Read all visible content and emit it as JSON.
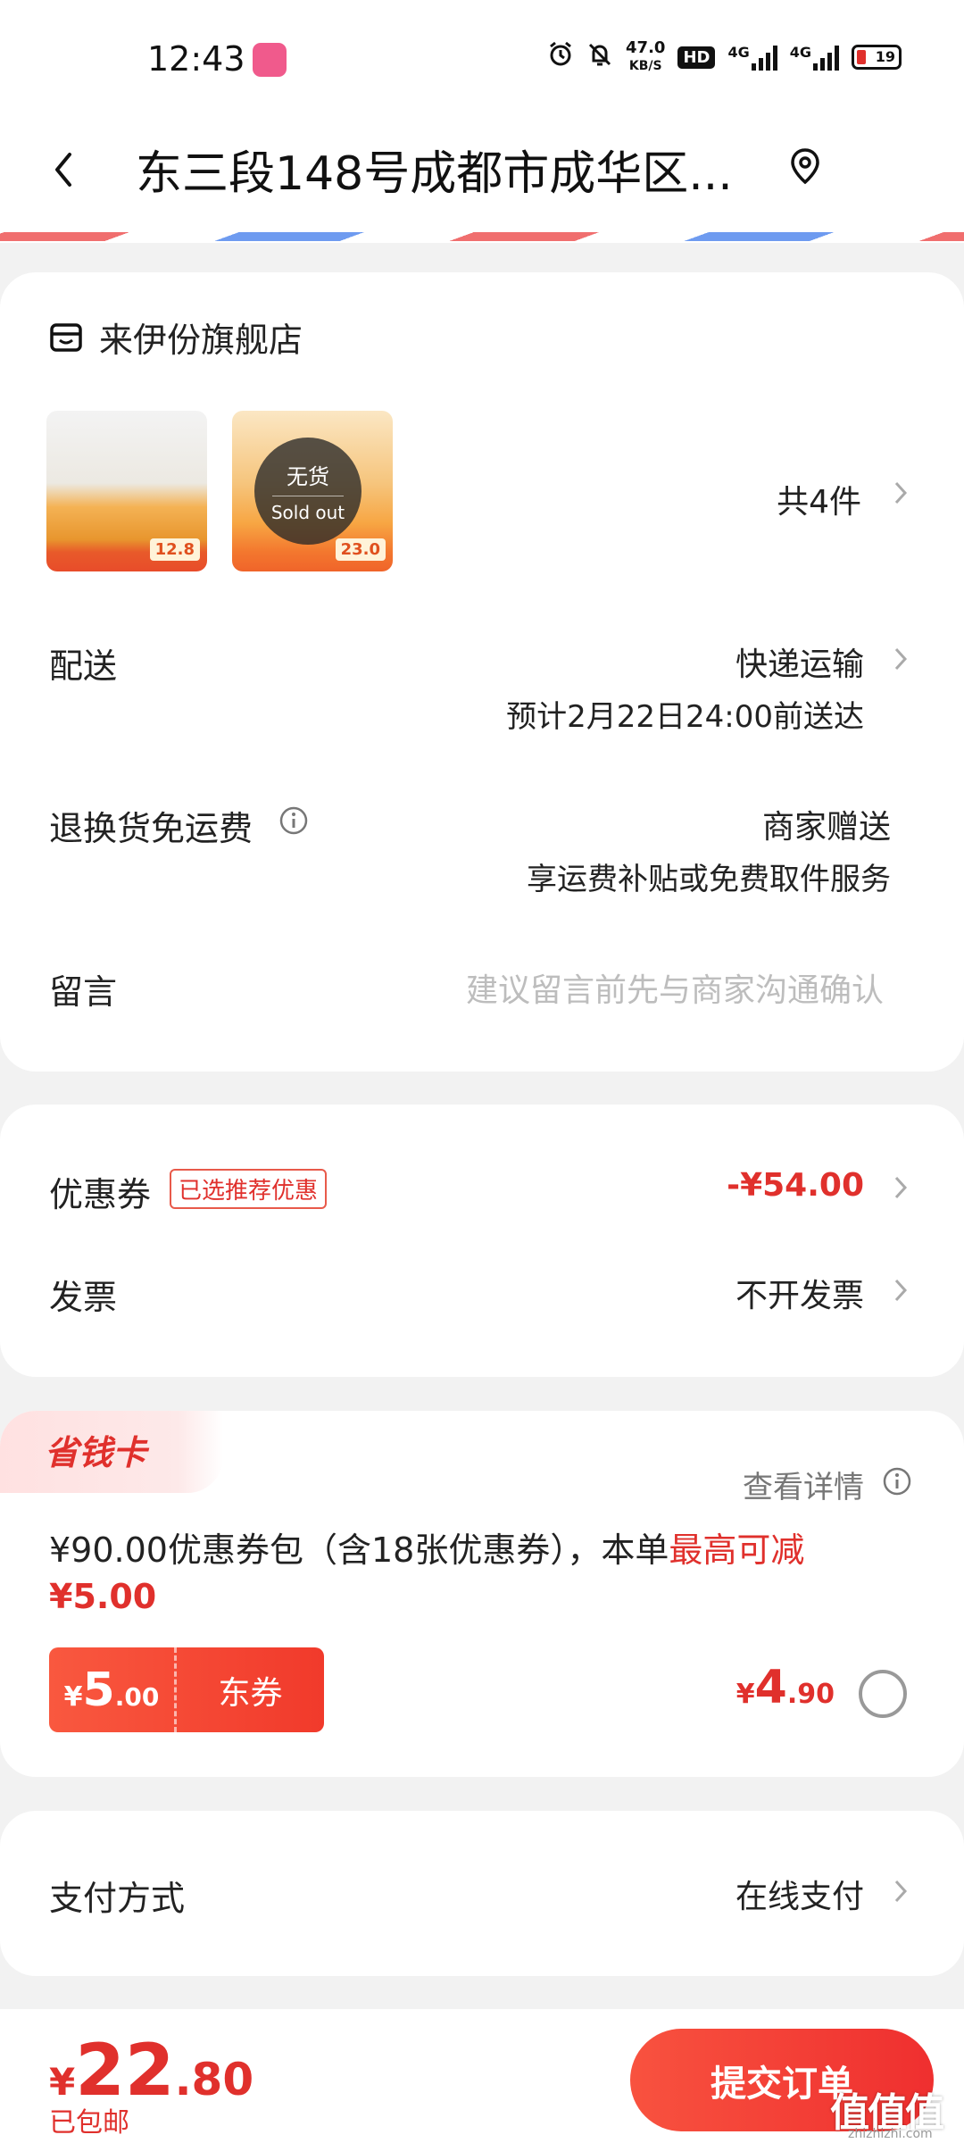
{
  "status_bar": {
    "time": "12:43",
    "net_speed_value": "47.0",
    "net_speed_unit": "KB/S",
    "hd_label": "HD",
    "signal1_label": "4G",
    "signal2_label": "4G",
    "battery": "19"
  },
  "header": {
    "title": "东三段148号成都市成华区..."
  },
  "shop": {
    "name": "来伊份旗舰店",
    "products": [
      {
        "price": "12.8"
      },
      {
        "price": "23.0",
        "overlay_zh": "无货",
        "overlay_en": "Sold out"
      }
    ],
    "count_label": "共4件"
  },
  "delivery": {
    "label": "配送",
    "method": "快递运输",
    "eta": "预计2月22日24:00前送达"
  },
  "returns": {
    "label": "退换货免运费",
    "value": "商家赠送",
    "sub": "享运费补贴或免费取件服务"
  },
  "message": {
    "label": "留言",
    "placeholder": "建议留言前先与商家沟通确认"
  },
  "coupon": {
    "label": "优惠券",
    "tag": "已选推荐优惠",
    "value": "-¥54.00"
  },
  "invoice": {
    "label": "发票",
    "value": "不开发票"
  },
  "savings_card": {
    "title": "省钱卡",
    "details_link": "查看详情",
    "desc_main": "¥90.00优惠券包（含18张优惠券），本单",
    "desc_highlight": "最高可减",
    "desc_amount": "¥5.00",
    "ticket_currency": "¥",
    "ticket_int": "5",
    "ticket_dec": ".00",
    "ticket_label": "东券",
    "price_currency": "¥",
    "price_int": "4",
    "price_dec": ".90",
    "selected": false
  },
  "payment": {
    "label": "支付方式",
    "value": "在线支付"
  },
  "footer": {
    "total_currency": "¥",
    "total_int": "22",
    "total_dec": ".80",
    "free_shipping": "已包邮",
    "submit_label": "提交订单"
  },
  "watermark": {
    "text": "值值值",
    "site": "zhizhizhi.com"
  },
  "colors": {
    "accent": "#e0302c",
    "background": "#f2f2f2"
  }
}
